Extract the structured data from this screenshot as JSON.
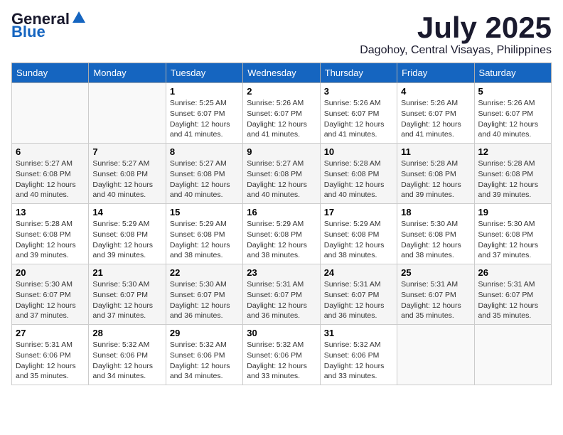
{
  "header": {
    "logo_general": "General",
    "logo_blue": "Blue",
    "month": "July 2025",
    "location": "Dagohoy, Central Visayas, Philippines"
  },
  "weekdays": [
    "Sunday",
    "Monday",
    "Tuesday",
    "Wednesday",
    "Thursday",
    "Friday",
    "Saturday"
  ],
  "weeks": [
    [
      {
        "day": "",
        "detail": ""
      },
      {
        "day": "",
        "detail": ""
      },
      {
        "day": "1",
        "detail": "Sunrise: 5:25 AM\nSunset: 6:07 PM\nDaylight: 12 hours and 41 minutes."
      },
      {
        "day": "2",
        "detail": "Sunrise: 5:26 AM\nSunset: 6:07 PM\nDaylight: 12 hours and 41 minutes."
      },
      {
        "day": "3",
        "detail": "Sunrise: 5:26 AM\nSunset: 6:07 PM\nDaylight: 12 hours and 41 minutes."
      },
      {
        "day": "4",
        "detail": "Sunrise: 5:26 AM\nSunset: 6:07 PM\nDaylight: 12 hours and 41 minutes."
      },
      {
        "day": "5",
        "detail": "Sunrise: 5:26 AM\nSunset: 6:07 PM\nDaylight: 12 hours and 40 minutes."
      }
    ],
    [
      {
        "day": "6",
        "detail": "Sunrise: 5:27 AM\nSunset: 6:08 PM\nDaylight: 12 hours and 40 minutes."
      },
      {
        "day": "7",
        "detail": "Sunrise: 5:27 AM\nSunset: 6:08 PM\nDaylight: 12 hours and 40 minutes."
      },
      {
        "day": "8",
        "detail": "Sunrise: 5:27 AM\nSunset: 6:08 PM\nDaylight: 12 hours and 40 minutes."
      },
      {
        "day": "9",
        "detail": "Sunrise: 5:27 AM\nSunset: 6:08 PM\nDaylight: 12 hours and 40 minutes."
      },
      {
        "day": "10",
        "detail": "Sunrise: 5:28 AM\nSunset: 6:08 PM\nDaylight: 12 hours and 40 minutes."
      },
      {
        "day": "11",
        "detail": "Sunrise: 5:28 AM\nSunset: 6:08 PM\nDaylight: 12 hours and 39 minutes."
      },
      {
        "day": "12",
        "detail": "Sunrise: 5:28 AM\nSunset: 6:08 PM\nDaylight: 12 hours and 39 minutes."
      }
    ],
    [
      {
        "day": "13",
        "detail": "Sunrise: 5:28 AM\nSunset: 6:08 PM\nDaylight: 12 hours and 39 minutes."
      },
      {
        "day": "14",
        "detail": "Sunrise: 5:29 AM\nSunset: 6:08 PM\nDaylight: 12 hours and 39 minutes."
      },
      {
        "day": "15",
        "detail": "Sunrise: 5:29 AM\nSunset: 6:08 PM\nDaylight: 12 hours and 38 minutes."
      },
      {
        "day": "16",
        "detail": "Sunrise: 5:29 AM\nSunset: 6:08 PM\nDaylight: 12 hours and 38 minutes."
      },
      {
        "day": "17",
        "detail": "Sunrise: 5:29 AM\nSunset: 6:08 PM\nDaylight: 12 hours and 38 minutes."
      },
      {
        "day": "18",
        "detail": "Sunrise: 5:30 AM\nSunset: 6:08 PM\nDaylight: 12 hours and 38 minutes."
      },
      {
        "day": "19",
        "detail": "Sunrise: 5:30 AM\nSunset: 6:08 PM\nDaylight: 12 hours and 37 minutes."
      }
    ],
    [
      {
        "day": "20",
        "detail": "Sunrise: 5:30 AM\nSunset: 6:07 PM\nDaylight: 12 hours and 37 minutes."
      },
      {
        "day": "21",
        "detail": "Sunrise: 5:30 AM\nSunset: 6:07 PM\nDaylight: 12 hours and 37 minutes."
      },
      {
        "day": "22",
        "detail": "Sunrise: 5:30 AM\nSunset: 6:07 PM\nDaylight: 12 hours and 36 minutes."
      },
      {
        "day": "23",
        "detail": "Sunrise: 5:31 AM\nSunset: 6:07 PM\nDaylight: 12 hours and 36 minutes."
      },
      {
        "day": "24",
        "detail": "Sunrise: 5:31 AM\nSunset: 6:07 PM\nDaylight: 12 hours and 36 minutes."
      },
      {
        "day": "25",
        "detail": "Sunrise: 5:31 AM\nSunset: 6:07 PM\nDaylight: 12 hours and 35 minutes."
      },
      {
        "day": "26",
        "detail": "Sunrise: 5:31 AM\nSunset: 6:07 PM\nDaylight: 12 hours and 35 minutes."
      }
    ],
    [
      {
        "day": "27",
        "detail": "Sunrise: 5:31 AM\nSunset: 6:06 PM\nDaylight: 12 hours and 35 minutes."
      },
      {
        "day": "28",
        "detail": "Sunrise: 5:32 AM\nSunset: 6:06 PM\nDaylight: 12 hours and 34 minutes."
      },
      {
        "day": "29",
        "detail": "Sunrise: 5:32 AM\nSunset: 6:06 PM\nDaylight: 12 hours and 34 minutes."
      },
      {
        "day": "30",
        "detail": "Sunrise: 5:32 AM\nSunset: 6:06 PM\nDaylight: 12 hours and 33 minutes."
      },
      {
        "day": "31",
        "detail": "Sunrise: 5:32 AM\nSunset: 6:06 PM\nDaylight: 12 hours and 33 minutes."
      },
      {
        "day": "",
        "detail": ""
      },
      {
        "day": "",
        "detail": ""
      }
    ]
  ]
}
